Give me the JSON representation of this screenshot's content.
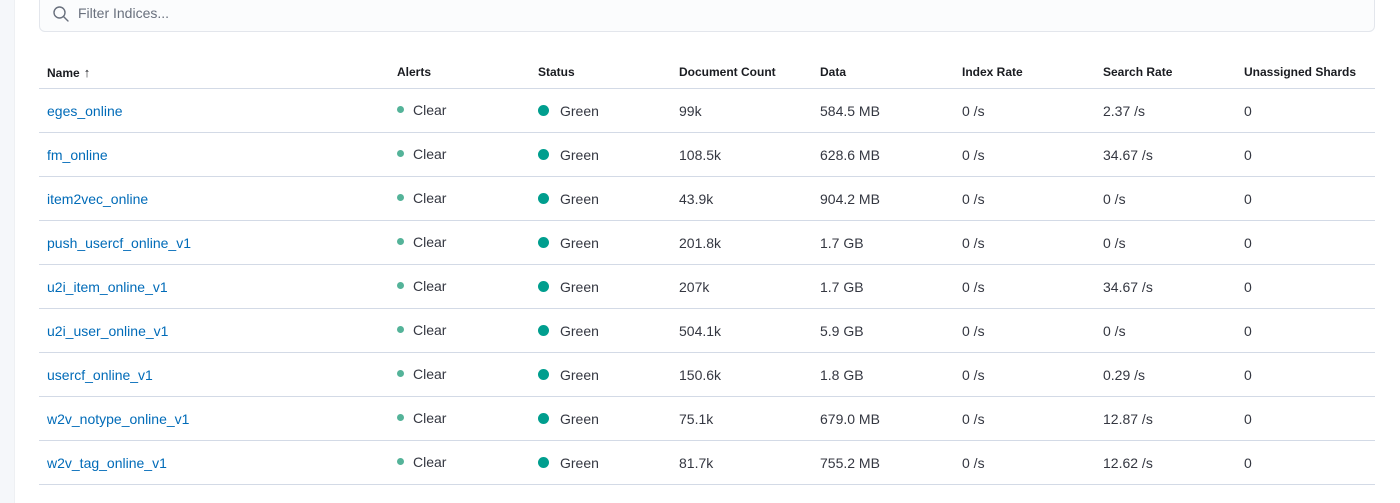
{
  "search": {
    "placeholder": "Filter Indices..."
  },
  "colors": {
    "link": "#006bb8",
    "alert_clear": "#54b399",
    "status_green": "#009e8e"
  },
  "table": {
    "columns": [
      {
        "label": "Name",
        "sort_icon": "arrow-up-icon",
        "sort_glyph": "↑"
      },
      {
        "label": "Alerts"
      },
      {
        "label": "Status"
      },
      {
        "label": "Document Count"
      },
      {
        "label": "Data"
      },
      {
        "label": "Index Rate"
      },
      {
        "label": "Search Rate"
      },
      {
        "label": "Unassigned Shards"
      }
    ],
    "rows": [
      {
        "name": "eges_online",
        "alerts": "Clear",
        "status": "Green",
        "document_count": "99k",
        "data": "584.5 MB",
        "index_rate": "0 /s",
        "search_rate": "2.37 /s",
        "unassigned_shards": "0"
      },
      {
        "name": "fm_online",
        "alerts": "Clear",
        "status": "Green",
        "document_count": "108.5k",
        "data": "628.6 MB",
        "index_rate": "0 /s",
        "search_rate": "34.67 /s",
        "unassigned_shards": "0"
      },
      {
        "name": "item2vec_online",
        "alerts": "Clear",
        "status": "Green",
        "document_count": "43.9k",
        "data": "904.2 MB",
        "index_rate": "0 /s",
        "search_rate": "0 /s",
        "unassigned_shards": "0"
      },
      {
        "name": "push_usercf_online_v1",
        "alerts": "Clear",
        "status": "Green",
        "document_count": "201.8k",
        "data": "1.7 GB",
        "index_rate": "0 /s",
        "search_rate": "0 /s",
        "unassigned_shards": "0"
      },
      {
        "name": "u2i_item_online_v1",
        "alerts": "Clear",
        "status": "Green",
        "document_count": "207k",
        "data": "1.7 GB",
        "index_rate": "0 /s",
        "search_rate": "34.67 /s",
        "unassigned_shards": "0"
      },
      {
        "name": "u2i_user_online_v1",
        "alerts": "Clear",
        "status": "Green",
        "document_count": "504.1k",
        "data": "5.9 GB",
        "index_rate": "0 /s",
        "search_rate": "0 /s",
        "unassigned_shards": "0"
      },
      {
        "name": "usercf_online_v1",
        "alerts": "Clear",
        "status": "Green",
        "document_count": "150.6k",
        "data": "1.8 GB",
        "index_rate": "0 /s",
        "search_rate": "0.29 /s",
        "unassigned_shards": "0"
      },
      {
        "name": "w2v_notype_online_v1",
        "alerts": "Clear",
        "status": "Green",
        "document_count": "75.1k",
        "data": "679.0 MB",
        "index_rate": "0 /s",
        "search_rate": "12.87 /s",
        "unassigned_shards": "0"
      },
      {
        "name": "w2v_tag_online_v1",
        "alerts": "Clear",
        "status": "Green",
        "document_count": "81.7k",
        "data": "755.2 MB",
        "index_rate": "0 /s",
        "search_rate": "12.62 /s",
        "unassigned_shards": "0"
      }
    ]
  }
}
